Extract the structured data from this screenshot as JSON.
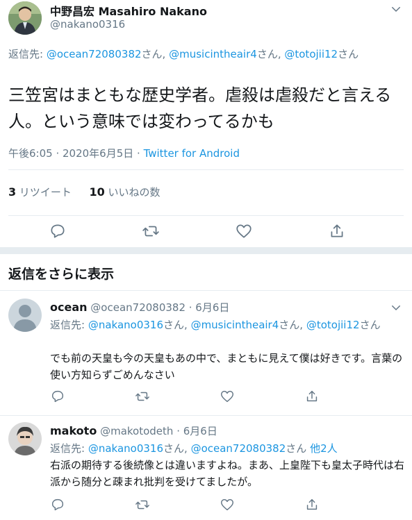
{
  "main_tweet": {
    "display_name": "中野昌宏 Masahiro Nakano",
    "handle": "@nakano0316",
    "reply_prefix": "返信先: ",
    "reply_mentions": [
      "@ocean72080382",
      "@musicintheair4",
      "@totojii12"
    ],
    "mention_suffix": "さん",
    "mention_sep": ", ",
    "text": "三笠宮はまともな歴史学者。虐殺は虐殺だと言える人。という意味では変わってるかも",
    "timestamp": "午後6:05 · 2020年6月5日 · ",
    "source": "Twitter for Android",
    "retweet_count": "3",
    "retweet_label": "リツイート",
    "like_count": "10",
    "like_label": "いいねの数"
  },
  "section_title": "返信をさらに表示",
  "replies": [
    {
      "name": "ocean",
      "meta": "@ocean72080382 · 6月6日",
      "reply_prefix": "返信先: ",
      "mentions": [
        "@nakano0316",
        "@musicintheair4",
        "@totojii12"
      ],
      "mention_suffix": "さん",
      "text": "でも前の天皇も今の天皇もあの中で、まともに見えて僕は好きです。言葉の使い方知らずごめんなさい"
    },
    {
      "name": "makoto",
      "meta": "@makotodeth · 6月6日",
      "reply_prefix": "返信先: ",
      "mentions": [
        "@nakano0316",
        "@ocean72080382"
      ],
      "mention_suffix": "さん",
      "others": "他2人",
      "text": "右派の期待する後続像とは違いますよね。まあ、上皇陛下も皇太子時代は右派から随分と疎まれ批判を受けてましたが。"
    }
  ],
  "icons": [
    "chevron-down-icon",
    "reply-icon",
    "retweet-icon",
    "like-icon",
    "share-icon"
  ],
  "colors": {
    "link": "#1b95e0",
    "muted": "#657786",
    "text": "#14171a",
    "divider": "#e6ecf0"
  }
}
